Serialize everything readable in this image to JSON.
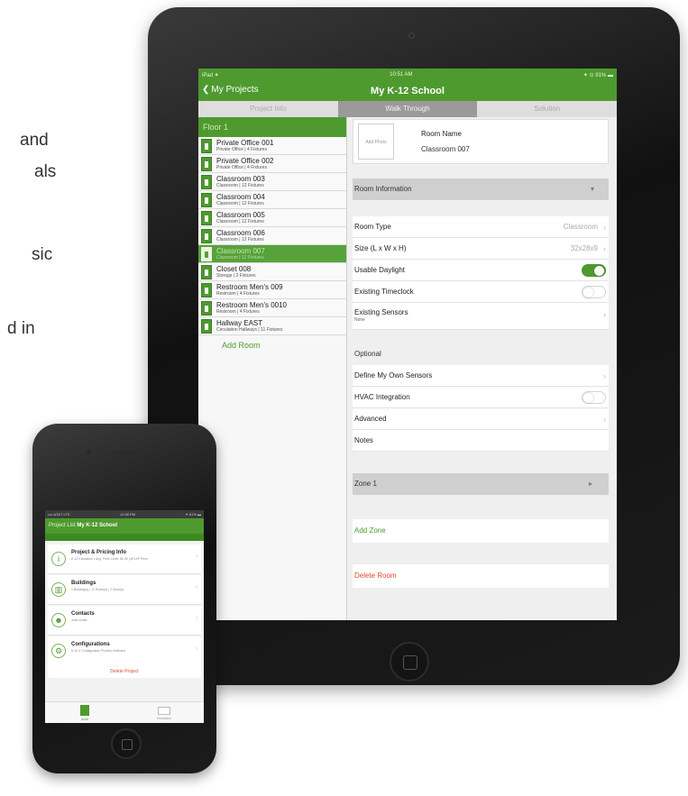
{
  "background_fragments": [
    "and",
    "als",
    "sic",
    "d in"
  ],
  "ipad": {
    "status": {
      "carrier": "iPad ✦",
      "time": "10:51 AM",
      "battery": "✦ ⊙ 91% ▬"
    },
    "nav": {
      "back_label": "My Projects",
      "title": "My K-12 School"
    },
    "segments": [
      "Project Info",
      "Walk Through",
      "Solution"
    ],
    "active_segment": "Walk Through",
    "floor": "Floor 1",
    "rooms": [
      {
        "name": "Private Office 001",
        "sub": "Private Office | 4 Fixtures"
      },
      {
        "name": "Private Office 002",
        "sub": "Private Office | 4 Fixtures"
      },
      {
        "name": "Classroom 003",
        "sub": "Classroom | 12 Fixtures"
      },
      {
        "name": "Classroom 004",
        "sub": "Classroom | 12 Fixtures"
      },
      {
        "name": "Classroom 005",
        "sub": "Classroom | 12 Fixtures"
      },
      {
        "name": "Classroom 006",
        "sub": "Classroom | 12 Fixtures"
      },
      {
        "name": "Classroom 007",
        "sub": "Classroom | 12 Fixtures",
        "selected": true
      },
      {
        "name": "Closet 008",
        "sub": "Storage | 2 Fixtures"
      },
      {
        "name": "Restroom Men's 009",
        "sub": "Restroom | 4 Fixtures"
      },
      {
        "name": "Restroom Men's 0010",
        "sub": "Restroom | 4 Fixtures"
      },
      {
        "name": "Hallway EAST",
        "sub": "Circulation Hallways | 11 Fixtures"
      }
    ],
    "add_room": "Add Room",
    "detail": {
      "add_photo": "Add Photo",
      "room_name_label": "Room Name",
      "room_name_value": "Classroom 007",
      "room_information": "Room Information",
      "room_type_label": "Room Type",
      "room_type_value": "Classroom",
      "size_label": "Size (L x W x H)",
      "size_value": "32x28x9",
      "usable_daylight_label": "Usable Daylight",
      "usable_daylight_on": true,
      "existing_timeclock_label": "Existing Timeclock",
      "existing_timeclock_on": false,
      "existing_sensors_label": "Existing Sensors",
      "existing_sensors_value": "None",
      "optional_label": "Optional",
      "define_sensors_label": "Define My Own Sensors",
      "hvac_label": "HVAC Integration",
      "hvac_on": false,
      "advanced_label": "Advanced",
      "notes_label": "Notes",
      "zone_label": "Zone 1",
      "add_zone": "Add Zone",
      "delete_room": "Delete Room"
    }
  },
  "iphone": {
    "status": {
      "left": "•••• AT&T LTE",
      "time": "12:58 PM",
      "right": "✦ 61% ▬"
    },
    "nav": {
      "prefix": "Project List",
      "title": "My K-12 School"
    },
    "items": [
      {
        "title": "Project & Pricing Info",
        "sub": "K-12 Education • Avg. Price Level: $0.00 | ATL4P Price",
        "icon": "info-icon",
        "glyph": "i"
      },
      {
        "title": "Buildings",
        "sub": "1 Building(s) | 11 Room(s) | 2 Zone(s)",
        "icon": "building-icon",
        "glyph": "▥"
      },
      {
        "title": "Contacts",
        "sub": "John Smith",
        "icon": "contact-icon",
        "glyph": "☻"
      },
      {
        "title": "Configurations",
        "sub": "0-10 V Configuration Position Selected",
        "icon": "gear-icon",
        "glyph": "⚙"
      }
    ],
    "delete_project": "Delete Project",
    "tabs": [
      "Audit",
      "Simulation"
    ]
  },
  "colors": {
    "brand_green": "#4e9a2f",
    "delete_red": "#e04a2c"
  }
}
